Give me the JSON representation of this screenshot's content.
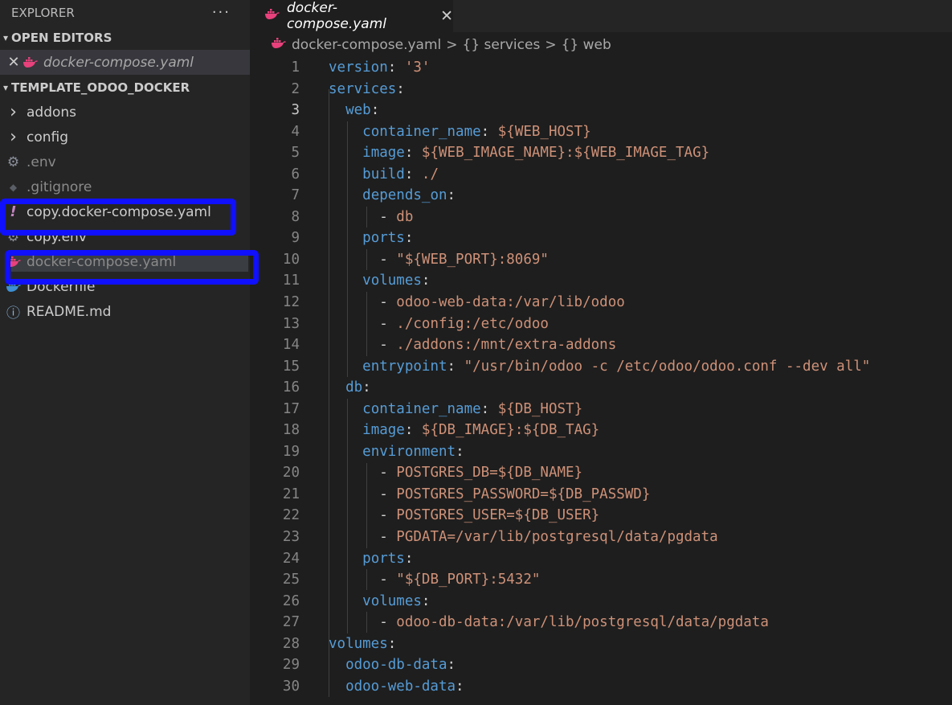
{
  "explorer": {
    "title": "EXPLORER",
    "more": "···",
    "open_editors_title": "OPEN EDITORS",
    "open_editor_file": "docker-compose.yaml",
    "project_title": "TEMPLATE_ODOO_DOCKER",
    "items": [
      {
        "label": "addons",
        "icon": "chevron-right-icon",
        "glyph": "›"
      },
      {
        "label": "config",
        "icon": "chevron-right-icon",
        "glyph": "›"
      },
      {
        "label": ".env",
        "icon": "gear-icon",
        "glyph": "⚙"
      },
      {
        "label": ".gitignore",
        "icon": "git-diamond-icon",
        "glyph": "◆"
      },
      {
        "label": "copy.docker-compose.yaml",
        "icon": "exclamation-icon",
        "glyph": "!"
      },
      {
        "label": "copy.env",
        "icon": "gear-icon",
        "glyph": "⚙"
      },
      {
        "label": "docker-compose.yaml",
        "icon": "docker-whale-icon",
        "glyph": ""
      },
      {
        "label": "Dockerfile",
        "icon": "docker-whale-icon",
        "glyph": ""
      },
      {
        "label": "README.md",
        "icon": "info-icon",
        "glyph": "ⓘ"
      }
    ]
  },
  "tab": {
    "label": "docker-compose.yaml",
    "close": "✕"
  },
  "breadcrumb": {
    "file": "docker-compose.yaml",
    "sep": ">",
    "parts": [
      "{} services",
      "{} web"
    ]
  },
  "active_line": 3,
  "code_lines": [
    [
      [
        "k",
        "version"
      ],
      [
        "p",
        ": "
      ],
      [
        "s",
        "'3'"
      ]
    ],
    [
      [
        "k",
        "services"
      ],
      [
        "p",
        ":"
      ]
    ],
    [
      [
        "p",
        "  "
      ],
      [
        "k",
        "web"
      ],
      [
        "p",
        ":"
      ]
    ],
    [
      [
        "p",
        "    "
      ],
      [
        "k",
        "container_name"
      ],
      [
        "p",
        ": "
      ],
      [
        "s",
        "${WEB_HOST}"
      ]
    ],
    [
      [
        "p",
        "    "
      ],
      [
        "k",
        "image"
      ],
      [
        "p",
        ": "
      ],
      [
        "s",
        "${WEB_IMAGE_NAME}:${WEB_IMAGE_TAG}"
      ]
    ],
    [
      [
        "p",
        "    "
      ],
      [
        "k",
        "build"
      ],
      [
        "p",
        ": "
      ],
      [
        "s",
        "./"
      ]
    ],
    [
      [
        "p",
        "    "
      ],
      [
        "k",
        "depends_on"
      ],
      [
        "p",
        ":"
      ]
    ],
    [
      [
        "p",
        "      - "
      ],
      [
        "s",
        "db"
      ]
    ],
    [
      [
        "p",
        "    "
      ],
      [
        "k",
        "ports"
      ],
      [
        "p",
        ":"
      ]
    ],
    [
      [
        "p",
        "      - "
      ],
      [
        "s",
        "\"${WEB_PORT}:8069\""
      ]
    ],
    [
      [
        "p",
        "    "
      ],
      [
        "k",
        "volumes"
      ],
      [
        "p",
        ":"
      ]
    ],
    [
      [
        "p",
        "      - "
      ],
      [
        "s",
        "odoo-web-data:/var/lib/odoo"
      ]
    ],
    [
      [
        "p",
        "      - "
      ],
      [
        "s",
        "./config:/etc/odoo"
      ]
    ],
    [
      [
        "p",
        "      - "
      ],
      [
        "s",
        "./addons:/mnt/extra-addons"
      ]
    ],
    [
      [
        "p",
        "    "
      ],
      [
        "k",
        "entrypoint"
      ],
      [
        "p",
        ": "
      ],
      [
        "s",
        "\"/usr/bin/odoo -c /etc/odoo/odoo.conf --dev all\""
      ]
    ],
    [
      [
        "p",
        "  "
      ],
      [
        "k",
        "db"
      ],
      [
        "p",
        ":"
      ]
    ],
    [
      [
        "p",
        "    "
      ],
      [
        "k",
        "container_name"
      ],
      [
        "p",
        ": "
      ],
      [
        "s",
        "${DB_HOST}"
      ]
    ],
    [
      [
        "p",
        "    "
      ],
      [
        "k",
        "image"
      ],
      [
        "p",
        ": "
      ],
      [
        "s",
        "${DB_IMAGE}:${DB_TAG}"
      ]
    ],
    [
      [
        "p",
        "    "
      ],
      [
        "k",
        "environment"
      ],
      [
        "p",
        ":"
      ]
    ],
    [
      [
        "p",
        "      - "
      ],
      [
        "s",
        "POSTGRES_DB=${DB_NAME}"
      ]
    ],
    [
      [
        "p",
        "      - "
      ],
      [
        "s",
        "POSTGRES_PASSWORD=${DB_PASSWD}"
      ]
    ],
    [
      [
        "p",
        "      - "
      ],
      [
        "s",
        "POSTGRES_USER=${DB_USER}"
      ]
    ],
    [
      [
        "p",
        "      - "
      ],
      [
        "s",
        "PGDATA=/var/lib/postgresql/data/pgdata"
      ]
    ],
    [
      [
        "p",
        "    "
      ],
      [
        "k",
        "ports"
      ],
      [
        "p",
        ":"
      ]
    ],
    [
      [
        "p",
        "      - "
      ],
      [
        "s",
        "\"${DB_PORT}:5432\""
      ]
    ],
    [
      [
        "p",
        "    "
      ],
      [
        "k",
        "volumes"
      ],
      [
        "p",
        ":"
      ]
    ],
    [
      [
        "p",
        "      - "
      ],
      [
        "s",
        "odoo-db-data:/var/lib/postgresql/data/pgdata"
      ]
    ],
    [
      [
        "k",
        "volumes"
      ],
      [
        "p",
        ":"
      ]
    ],
    [
      [
        "p",
        "  "
      ],
      [
        "k",
        "odoo-db-data"
      ],
      [
        "p",
        ":"
      ]
    ],
    [
      [
        "p",
        "  "
      ],
      [
        "k",
        "odoo-web-data"
      ],
      [
        "p",
        ":"
      ]
    ]
  ],
  "colors": {
    "keyword": "#569cd6",
    "string": "#ce9178",
    "annotation_box": "#1010ff",
    "docker_icon": "#e8417c",
    "exclamation": "#c586c0"
  }
}
